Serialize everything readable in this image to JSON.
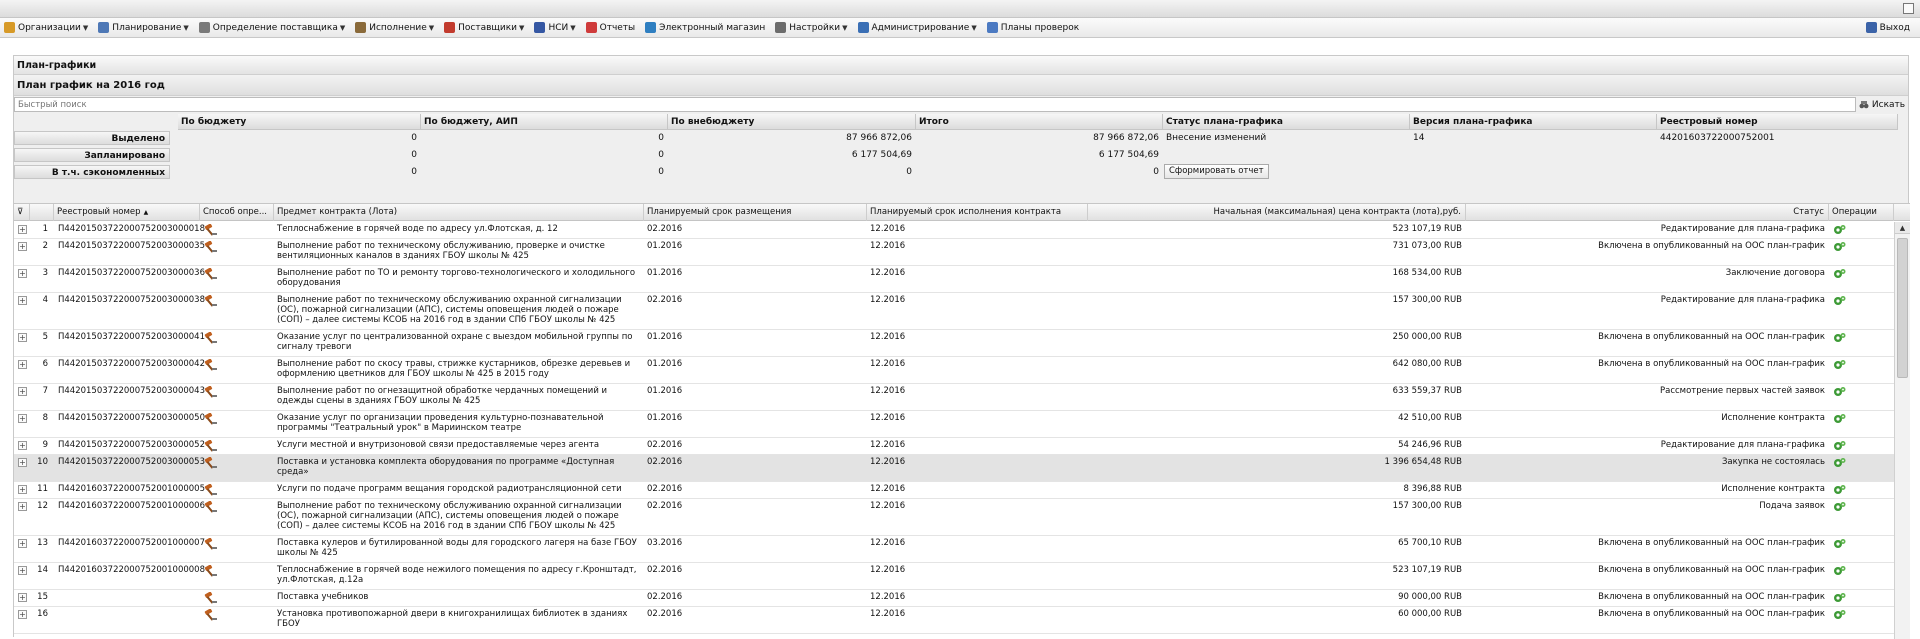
{
  "menu": {
    "items": [
      {
        "label": "Организации",
        "icon": "folder-icon",
        "color": "#d79a28",
        "dropdown": true
      },
      {
        "label": "Планирование",
        "icon": "grid-icon",
        "color": "#4e78b6",
        "dropdown": true
      },
      {
        "label": "Определение поставщика",
        "icon": "gear-icon",
        "color": "#7a7a7a",
        "dropdown": true
      },
      {
        "label": "Исполнение",
        "icon": "briefcase-icon",
        "color": "#8a6a3a",
        "dropdown": true
      },
      {
        "label": "Поставщики",
        "icon": "clock-icon",
        "color": "#c23b2e",
        "dropdown": true
      },
      {
        "label": "НСИ",
        "icon": "book-icon",
        "color": "#3557a3",
        "dropdown": true
      },
      {
        "label": "Отчеты",
        "icon": "report-icon",
        "color": "#cf3b3b",
        "dropdown": false
      },
      {
        "label": "Электронный магазин",
        "icon": "cart-icon",
        "color": "#2f7fc1",
        "dropdown": false
      },
      {
        "label": "Настройки",
        "icon": "wrench-icon",
        "color": "#6c6c6c",
        "dropdown": true
      },
      {
        "label": "Администрирование",
        "icon": "user-icon",
        "color": "#3a6fb5",
        "dropdown": true
      },
      {
        "label": "Планы проверок",
        "icon": "user-icon",
        "color": "#4c7ac2",
        "dropdown": false
      }
    ],
    "logout": "Выход"
  },
  "panel": {
    "title": "План-графики",
    "subtitle": "План график на 2016 год"
  },
  "search": {
    "placeholder": "Быстрый поиск",
    "button": "Искать"
  },
  "summary": {
    "headers": [
      "По бюджету",
      "По бюджету, АИП",
      "По внебюджету",
      "Итого",
      "Статус плана-графика",
      "Версия плана-графика",
      "Реестровый номер"
    ],
    "rows": [
      {
        "label": "Выделено",
        "values": [
          "0",
          "0",
          "87 966 872,06",
          "87 966 872,06"
        ]
      },
      {
        "label": "Запланировано",
        "values": [
          "0",
          "0",
          "6 177 504,69",
          "6 177 504,69"
        ]
      },
      {
        "label": "В т.ч. сэкономленных",
        "values": [
          "0",
          "0",
          "0",
          "0"
        ]
      }
    ],
    "status": "Внесение изменений",
    "version": "14",
    "registry": "44201603722000752001",
    "report_button": "Сформировать отчет"
  },
  "grid": {
    "columns": [
      "Реестровый номер",
      "Способ опре...",
      "Предмет контракта (Лота)",
      "Планируемый срок размещения",
      "Планируемый срок исполнения контракта",
      "Начальная (максимальная) цена контракта (лота),руб.",
      "Статус",
      "Операции"
    ],
    "sort_indicator": "▲",
    "rows": [
      {
        "n": "1",
        "reg": "П44201503722000752003000018",
        "subject": "Теплоснабжение в горячей воде по адресу ул.Флотская, д. 12",
        "place": "02.2016",
        "exec": "12.2016",
        "price": "523 107,19 RUB",
        "status": "Редактирование для плана-графика"
      },
      {
        "n": "2",
        "reg": "П44201503722000752003000035",
        "subject": "Выполнение работ по техническому обслуживанию, проверке и очистке вентиляционных каналов в зданиях ГБОУ школы № 425",
        "place": "01.2016",
        "exec": "12.2016",
        "price": "731 073,00 RUB",
        "status": "Включена в опубликованный на ООС план-график"
      },
      {
        "n": "3",
        "reg": "П44201503722000752003000036",
        "subject": "Выполнение работ по ТО и ремонту торгово-технологического и холодильного оборудования",
        "place": "01.2016",
        "exec": "12.2016",
        "price": "168 534,00 RUB",
        "status": "Заключение договора"
      },
      {
        "n": "4",
        "reg": "П44201503722000752003000038",
        "subject": "Выполнение работ по техническому обслуживанию охранной сигнализации (ОС), пожарной сигнализации (АПС), системы оповещения людей о пожаре (СОП) – далее системы КСОБ на 2016 год в здании СПб ГБОУ школы № 425",
        "place": "02.2016",
        "exec": "12.2016",
        "price": "157 300,00 RUB",
        "status": "Редактирование для плана-графика"
      },
      {
        "n": "5",
        "reg": "П44201503722000752003000041",
        "subject": "Оказание услуг по централизованной охране с выездом мобильной группы по сигналу тревоги",
        "place": "01.2016",
        "exec": "12.2016",
        "price": "250 000,00 RUB",
        "status": "Включена в опубликованный на ООС план-график"
      },
      {
        "n": "6",
        "reg": "П44201503722000752003000042",
        "subject": "Выполнение работ по скосу травы, стрижке кустарников, обрезке деревьев и оформлению цветников для ГБОУ школы № 425 в 2015 году",
        "place": "01.2016",
        "exec": "12.2016",
        "price": "642 080,00 RUB",
        "status": "Включена в опубликованный на ООС план-график"
      },
      {
        "n": "7",
        "reg": "П44201503722000752003000043",
        "subject": "Выполнение работ по огнезащитной обработке чердачных помещений и одежды сцены в зданиях ГБОУ школы № 425",
        "place": "01.2016",
        "exec": "12.2016",
        "price": "633 559,37 RUB",
        "status": "Рассмотрение первых частей заявок"
      },
      {
        "n": "8",
        "reg": "П44201503722000752003000050",
        "subject": "Оказание услуг по организации проведения культурно-познавательной программы \"Театральный урок\" в Мариинском театре",
        "place": "01.2016",
        "exec": "12.2016",
        "price": "42 510,00 RUB",
        "status": "Исполнение контракта"
      },
      {
        "n": "9",
        "reg": "П44201503722000752003000052",
        "subject": "Услуги местной и внутризоновой связи предоставляемые через агента",
        "place": "02.2016",
        "exec": "12.2016",
        "price": "54 246,96 RUB",
        "status": "Редактирование для плана-графика"
      },
      {
        "n": "10",
        "reg": "П44201503722000752003000053",
        "subject": "Поставка и установка комплекта оборудования по программе «Доступная среда»",
        "place": "02.2016",
        "exec": "12.2016",
        "price": "1 396 654,48 RUB",
        "status": "Закупка не состоялась"
      },
      {
        "n": "11",
        "reg": "П44201603722000752001000005",
        "subject": "Услуги по подаче программ вещания городской радиотрансляционной сети",
        "place": "02.2016",
        "exec": "12.2016",
        "price": "8 396,88 RUB",
        "status": "Исполнение контракта"
      },
      {
        "n": "12",
        "reg": "П44201603722000752001000006",
        "subject": "Выполнение работ по техническому обслуживанию охранной сигнализации (ОС), пожарной сигнализации (АПС), системы оповещения людей о пожаре (СОП) – далее системы КСОБ на 2016 год в здании СПб ГБОУ школы № 425",
        "place": "02.2016",
        "exec": "12.2016",
        "price": "157 300,00 RUB",
        "status": "Подача заявок"
      },
      {
        "n": "13",
        "reg": "П44201603722000752001000007",
        "subject": "Поставка кулеров и бутилированной воды для городского лагеря на базе ГБОУ школы № 425",
        "place": "03.2016",
        "exec": "12.2016",
        "price": "65 700,10 RUB",
        "status": "Включена в опубликованный на ООС план-график"
      },
      {
        "n": "14",
        "reg": "П44201603722000752001000008",
        "subject": "Теплоснабжение в горячей воде нежилого помещения по адресу г.Кронштадт, ул.Флотская, д.12а",
        "place": "02.2016",
        "exec": "12.2016",
        "price": "523 107,19 RUB",
        "status": "Включена в опубликованный на ООС план-график"
      },
      {
        "n": "15",
        "reg": "",
        "subject": "Поставка учебников",
        "place": "02.2016",
        "exec": "12.2016",
        "price": "90 000,00 RUB",
        "status": "Включена в опубликованный на ООС план-график"
      },
      {
        "n": "16",
        "reg": "",
        "subject": "Установка противопожарной двери в книгохранилищах библиотек в зданиях ГБОУ",
        "place": "02.2016",
        "exec": "12.2016",
        "price": "60 000,00 RUB",
        "status": "Включена в опубликованный на ООС план-график"
      }
    ],
    "selected_row": 10
  }
}
